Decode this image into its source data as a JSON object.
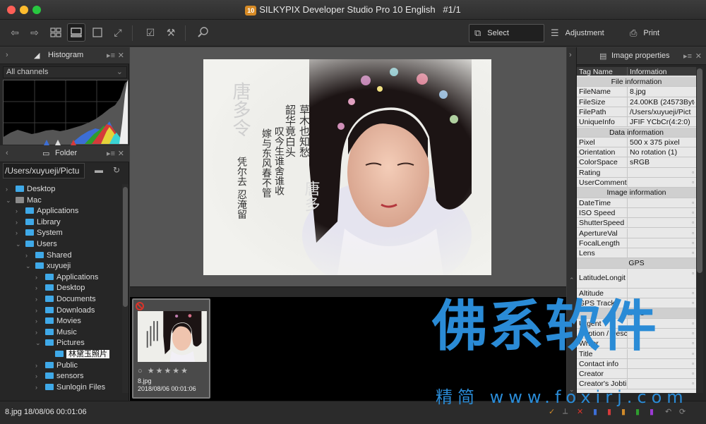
{
  "window": {
    "title": "SILKYPIX Developer Studio Pro 10 English",
    "page_indicator": "#1/1",
    "badge": "10"
  },
  "toolbar": {
    "modes": [
      {
        "label": "Select",
        "icon": "select-icon",
        "selected": true
      },
      {
        "label": "Adjustment",
        "icon": "adjustment-sliders-icon",
        "selected": false
      },
      {
        "label": "Print",
        "icon": "printer-icon",
        "selected": false
      }
    ]
  },
  "histogram_panel": {
    "title": "Histogram",
    "channel": "All channels"
  },
  "folder_panel": {
    "title": "Folder",
    "path": "/Users/xuyueji/Pictu",
    "tree": [
      {
        "label": "Desktop",
        "depth": 0,
        "expanded": false,
        "grey": false
      },
      {
        "label": "Mac",
        "depth": 0,
        "expanded": true,
        "grey": true
      },
      {
        "label": "Applications",
        "depth": 1,
        "expanded": false,
        "grey": false
      },
      {
        "label": "Library",
        "depth": 1,
        "expanded": false,
        "grey": false
      },
      {
        "label": "System",
        "depth": 1,
        "expanded": false,
        "grey": false
      },
      {
        "label": "Users",
        "depth": 1,
        "expanded": true,
        "grey": false
      },
      {
        "label": "Shared",
        "depth": 2,
        "expanded": false,
        "grey": false
      },
      {
        "label": "xuyueji",
        "depth": 2,
        "expanded": true,
        "grey": false
      },
      {
        "label": "Applications",
        "depth": 3,
        "expanded": false,
        "grey": false
      },
      {
        "label": "Desktop",
        "depth": 3,
        "expanded": false,
        "grey": false
      },
      {
        "label": "Documents",
        "depth": 3,
        "expanded": false,
        "grey": false
      },
      {
        "label": "Downloads",
        "depth": 3,
        "expanded": false,
        "grey": false
      },
      {
        "label": "Movies",
        "depth": 3,
        "expanded": false,
        "grey": false
      },
      {
        "label": "Music",
        "depth": 3,
        "expanded": false,
        "grey": false
      },
      {
        "label": "Pictures",
        "depth": 3,
        "expanded": true,
        "grey": false
      },
      {
        "label": "林黛玉照片",
        "depth": 4,
        "expanded": false,
        "grey": false,
        "selected": true
      },
      {
        "label": "Public",
        "depth": 3,
        "expanded": false,
        "grey": false
      },
      {
        "label": "sensors",
        "depth": 3,
        "expanded": false,
        "grey": false
      },
      {
        "label": "Sunlogin Files",
        "depth": 3,
        "expanded": false,
        "grey": false
      }
    ]
  },
  "image_calligraphy": {
    "title": "唐多令",
    "columns": [
      "草木也知愁",
      "韶华竟白头",
      "叹今生谁舍谁收",
      "嫁与东风春不管",
      "凭尔去 忍淹留"
    ],
    "side": "唐多"
  },
  "thumbnail": {
    "filename": "8.jpg",
    "datetime": "2018/08/06 00:01:06",
    "stars": "★★★★★",
    "rating_dot": "○"
  },
  "properties_panel": {
    "title": "Image properties",
    "columns": {
      "name": "Tag Name",
      "info": "Information"
    },
    "rows": [
      {
        "type": "section",
        "label": "File information"
      },
      {
        "key": "FileName",
        "value": "8.jpg"
      },
      {
        "key": "FileSize",
        "value": "24.00KB (24573Byte"
      },
      {
        "key": "FilePath",
        "value": "/Users/xuyueji/Pict"
      },
      {
        "key": "UniqueInfo",
        "value": "JFIF YCbCr(4:2:0)"
      },
      {
        "type": "section",
        "label": "Data information"
      },
      {
        "key": "Pixel",
        "value": "500 x 375 pixel"
      },
      {
        "key": "Orientation",
        "value": "No rotation (1)"
      },
      {
        "key": "ColorSpace",
        "value": "sRGB"
      },
      {
        "key": "Rating",
        "value": "",
        "dot": true
      },
      {
        "key": "UserComment",
        "value": "",
        "dot": true
      },
      {
        "type": "section",
        "label": "Image information"
      },
      {
        "key": "DateTime",
        "value": "",
        "dot": true
      },
      {
        "key": "ISO Speed",
        "value": "",
        "dot": true
      },
      {
        "key": "ShutterSpeed",
        "value": "",
        "dot": true
      },
      {
        "key": "ApertureVal",
        "value": "",
        "dot": true
      },
      {
        "key": "FocalLength",
        "value": "",
        "dot": true
      },
      {
        "key": "Lens",
        "value": "",
        "dot": true
      },
      {
        "type": "section",
        "label": "GPS"
      },
      {
        "key": "LatitudeLongit",
        "value": "",
        "dot": true,
        "tall": true
      },
      {
        "key": "Altitude",
        "value": "",
        "dot": true
      },
      {
        "key": "GPS Track",
        "value": "",
        "dot": true
      },
      {
        "type": "section",
        "label": "IPTC"
      },
      {
        "key": "Urgent",
        "value": "",
        "dot": true
      },
      {
        "key": "Caption / Descr",
        "value": "",
        "dot": true
      },
      {
        "key": "Writer",
        "value": "",
        "dot": true
      },
      {
        "key": "Title",
        "value": "",
        "dot": true
      },
      {
        "key": "Contact info",
        "value": "",
        "dot": true
      },
      {
        "key": "Creator",
        "value": "",
        "dot": true
      },
      {
        "key": "Creator's Jobti",
        "value": "",
        "dot": true
      }
    ]
  },
  "status_bar": {
    "text": "8.jpg 18/08/06 00:01:06"
  },
  "watermark": {
    "main": "佛系软件",
    "sub": "精简 www.foxirj.com"
  },
  "colors": {
    "accent_blue": "#3fa9e8",
    "watermark_blue": "#2a8bd6",
    "badge_orange": "#d68a25",
    "reject_red": "#d9342a"
  }
}
